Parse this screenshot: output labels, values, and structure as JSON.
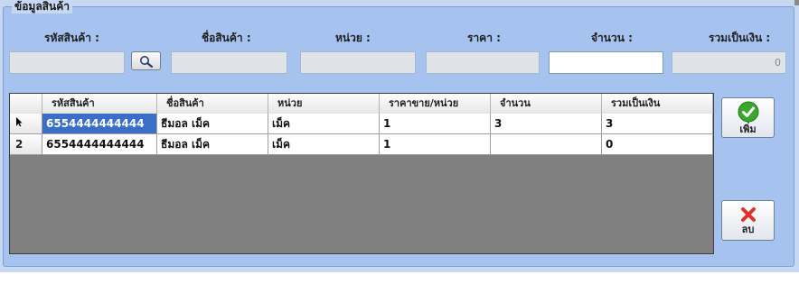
{
  "group_title": "ข้อมูลสินค้า",
  "labels": {
    "product_code": "รหัสสินค้า  :",
    "product_name": "ชื่อสินค้า  :",
    "unit": "หน่วย  :",
    "price": "ราคา  :",
    "quantity": "จำนวน  :",
    "total": "รวมเป็นเงิน  :"
  },
  "fields": {
    "product_code": "",
    "product_name": "",
    "unit": "",
    "price": "",
    "quantity": "",
    "total": "0"
  },
  "grid": {
    "columns": [
      "รหัสสินค้า",
      "ชื่อสินค้า",
      "หน่วย",
      "ราคาขาย/หน่วย",
      "จำนวน",
      "รวมเป็นเงิน"
    ],
    "rows": [
      {
        "row_header": "",
        "cells": [
          "6554444444444",
          "ธีมอล เม็ค",
          "เม็ค",
          "1",
          "3",
          "3"
        ]
      },
      {
        "row_header": "2",
        "cells": [
          "6554444444444",
          "ธีมอล เม็ค",
          "เม็ค",
          "1",
          "",
          "0"
        ]
      }
    ]
  },
  "buttons": {
    "add": "เพิ่ม",
    "delete": "ลบ"
  },
  "icons": {
    "search": "magnifier-icon",
    "add": "green-check-icon",
    "delete": "red-x-icon",
    "row_pointer": "row-pointer-icon"
  },
  "colors": {
    "panel": "#a6c2ef",
    "selection": "#3a6fc9",
    "grid_background": "#808080",
    "add_icon": "#3aa62a",
    "delete_icon": "#e0322a"
  }
}
